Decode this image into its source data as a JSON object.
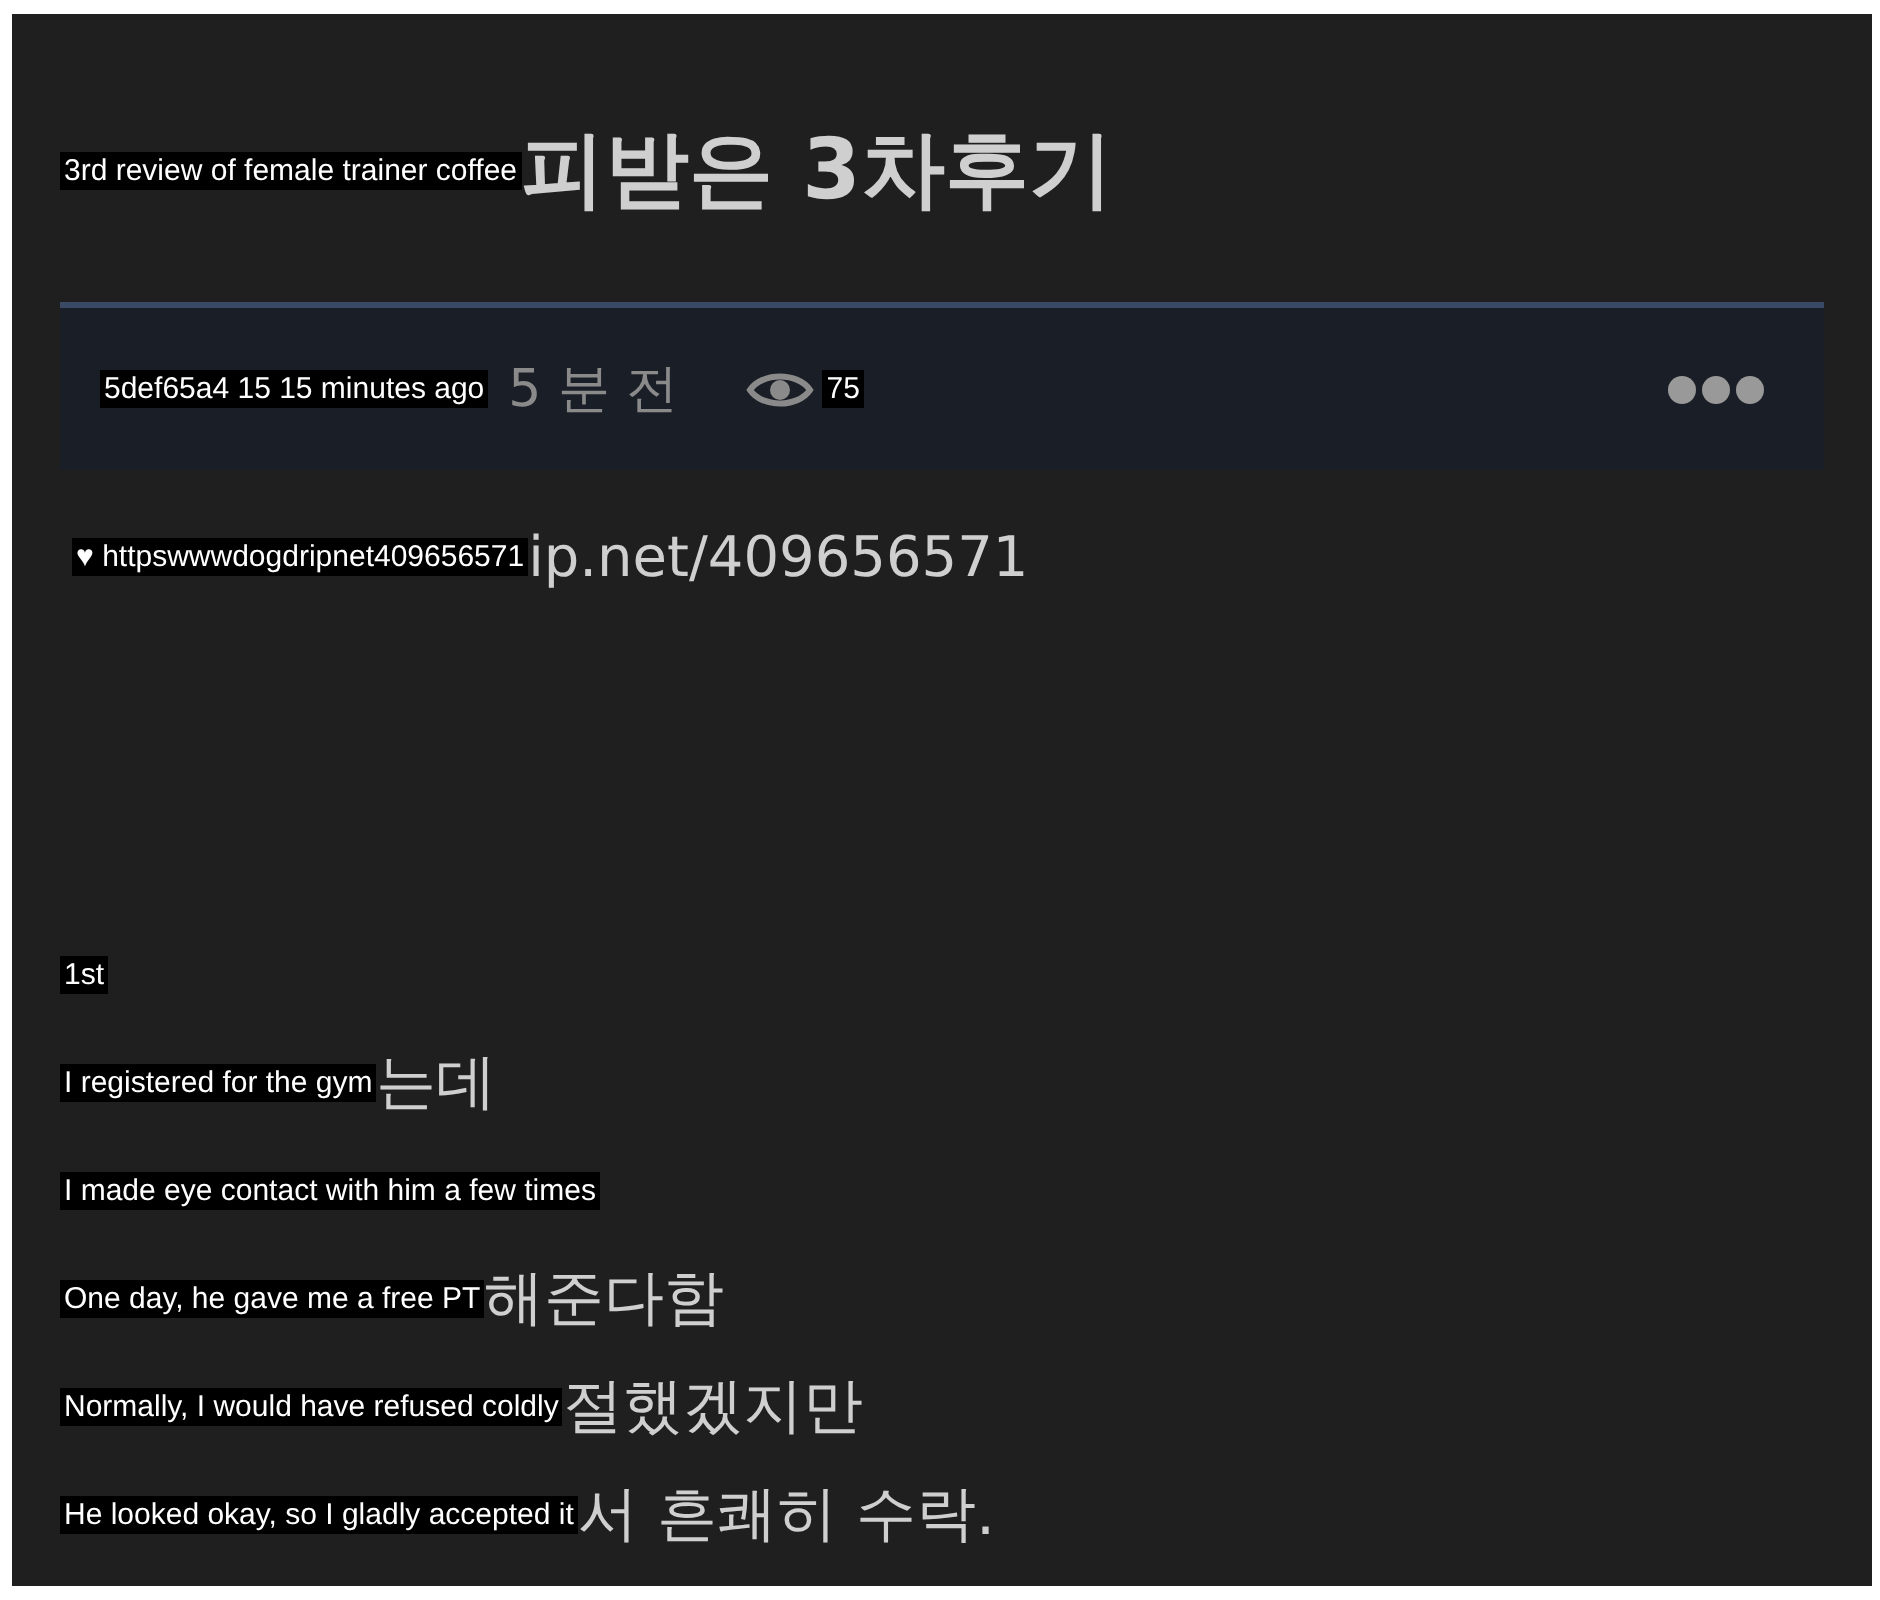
{
  "title": {
    "caption": "3rd review of female trainer coffee",
    "visible": "피받은 3차후기"
  },
  "meta": {
    "caption": "5def65a4  15 15 minutes ago",
    "time_visible": "5 분 전",
    "views": "75"
  },
  "link": {
    "caption": "♥ httpswwwdogdripnet409656571",
    "visible": "ip.net/409656571"
  },
  "lines": [
    {
      "caption": "1st"
    },
    {
      "caption": "I registered for the gym",
      "visible": "는데"
    },
    {
      "caption": "I made eye contact with him a few times"
    },
    {
      "caption": "One day, he gave me a free PT",
      "visible": "해준다함"
    },
    {
      "caption": "Normally, I would have refused coldly",
      "visible": "절했겠지만"
    },
    {
      "caption": "He looked okay, so I gladly accepted it",
      "visible": "서 흔쾌히 수락."
    }
  ]
}
